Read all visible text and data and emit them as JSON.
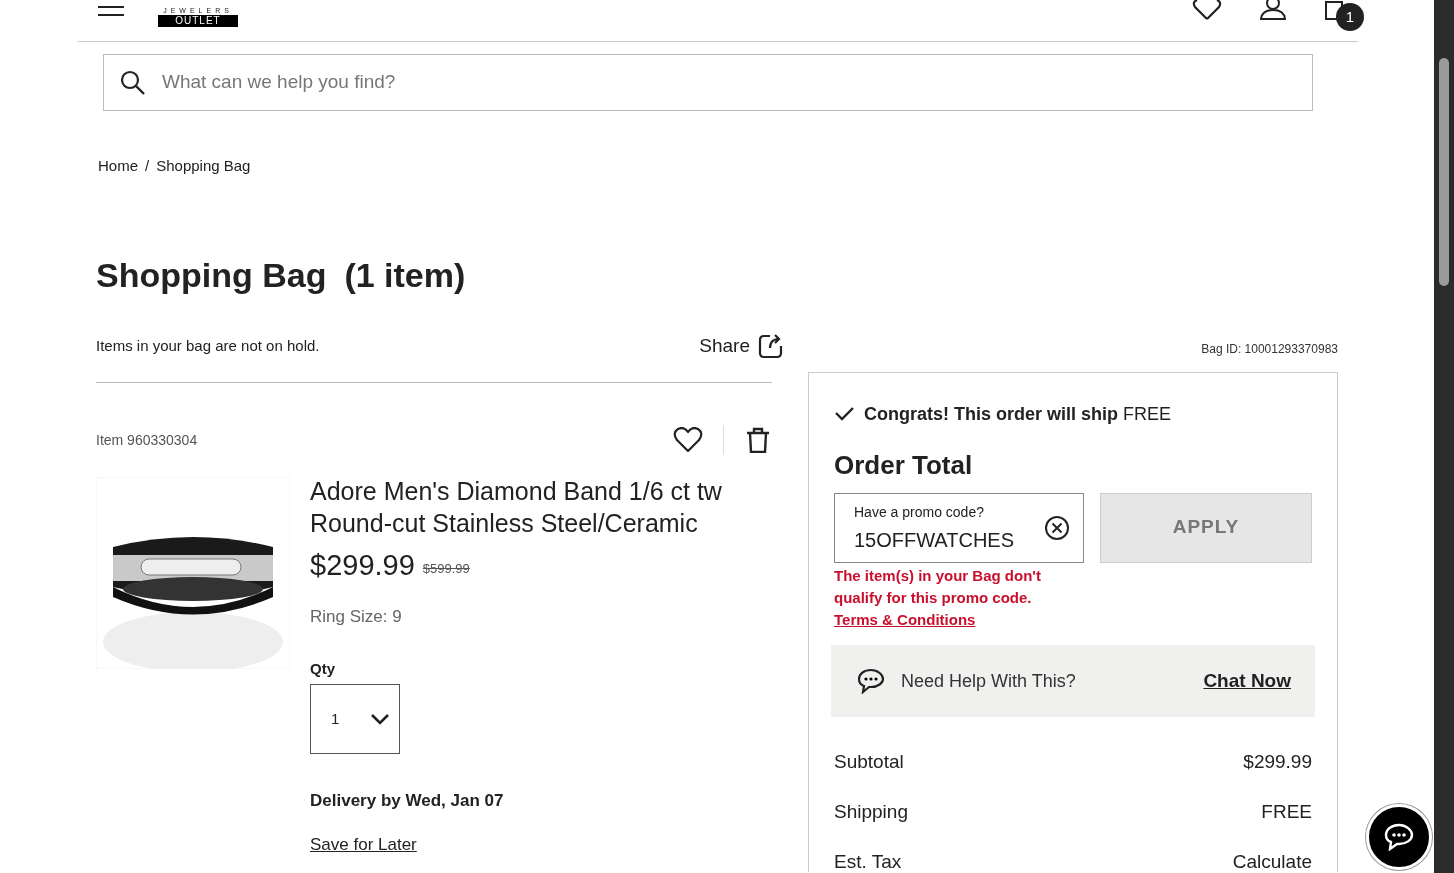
{
  "header": {
    "logo_line_1": "JEWELERS",
    "logo_line_2": "OUTLET",
    "bag_count": "1"
  },
  "search": {
    "placeholder": "What can we help you find?"
  },
  "breadcrumb": [
    {
      "label": "Home"
    },
    {
      "label": "Shopping Bag"
    }
  ],
  "breadcrumb_separator": "/",
  "page_title": "Shopping Bag",
  "item_count": "(1 item)",
  "hold_notice": "Items in your bag are not on hold.",
  "share_label": "Share",
  "bag_id": "Bag ID: 10001293370983",
  "item": {
    "number": "Item 960330304",
    "name": "Adore Men's Diamond Band 1/6 ct tw Round-cut Stainless Steel/Ceramic",
    "price": "$299.99",
    "was_price": "$599.99",
    "ring_size": "Ring Size: 9",
    "qty_label": "Qty",
    "qty": "1",
    "delivery": "Delivery by Wed, Jan 07",
    "save_for_later": "Save for Later"
  },
  "summary": {
    "ship_message": "**Congrats! This order will ship** FREE",
    "title": "Order Total",
    "promo": {
      "label": "Have a promo code?",
      "value": "15OFFWATCHES",
      "error": "The item(s) in your Bag don't qualify for this promo code.",
      "terms": "Terms & Conditions"
    },
    "apply": {
      "label": "APPLY",
      "disabled": true
    },
    "help": {
      "text": "Need Help With This?",
      "link": "Chat Now"
    },
    "lines": [
      {
        "label": "Subtotal",
        "value": "$299.99"
      },
      {
        "label": "Shipping",
        "value": "FREE"
      },
      {
        "label": "Est. Tax",
        "value": "Calculate"
      }
    ]
  }
}
